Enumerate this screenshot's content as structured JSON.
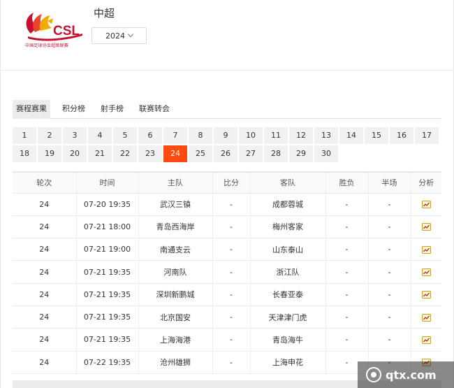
{
  "league": {
    "logo_text": "CSL",
    "logo_caption": "中国足球协会超级联赛",
    "title": "中超",
    "season": "2024"
  },
  "tabs": [
    {
      "label": "赛程赛果",
      "active": true
    },
    {
      "label": "积分榜",
      "active": false
    },
    {
      "label": "射手榜",
      "active": false
    },
    {
      "label": "联赛转会",
      "active": false
    }
  ],
  "rounds": {
    "row1": [
      "1",
      "2",
      "3",
      "4",
      "5",
      "6",
      "7",
      "8",
      "9",
      "10",
      "11",
      "12",
      "13",
      "14",
      "15",
      "16",
      "17"
    ],
    "row2": [
      "18",
      "19",
      "20",
      "21",
      "22",
      "23",
      "24",
      "25",
      "26",
      "27",
      "28",
      "29",
      "30"
    ],
    "active": "24"
  },
  "table": {
    "headers": [
      "轮次",
      "时间",
      "主队",
      "比分",
      "客队",
      "胜负",
      "半场",
      "分析"
    ],
    "rows": [
      {
        "round": "24",
        "time": "07-20 19:35",
        "home": "武汉三镇",
        "score": "-",
        "away": "成都蓉城",
        "result": "-",
        "half": "-"
      },
      {
        "round": "24",
        "time": "07-21 18:00",
        "home": "青岛西海岸",
        "score": "-",
        "away": "梅州客家",
        "result": "-",
        "half": "-"
      },
      {
        "round": "24",
        "time": "07-21 19:00",
        "home": "南通支云",
        "score": "-",
        "away": "山东泰山",
        "result": "-",
        "half": "-"
      },
      {
        "round": "24",
        "time": "07-21 19:35",
        "home": "河南队",
        "score": "-",
        "away": "浙江队",
        "result": "-",
        "half": "-"
      },
      {
        "round": "24",
        "time": "07-21 19:35",
        "home": "深圳新鹏城",
        "score": "-",
        "away": "长春亚泰",
        "result": "-",
        "half": "-"
      },
      {
        "round": "24",
        "time": "07-21 19:35",
        "home": "北京国安",
        "score": "-",
        "away": "天津津门虎",
        "result": "-",
        "half": "-"
      },
      {
        "round": "24",
        "time": "07-21 19:35",
        "home": "上海海港",
        "score": "-",
        "away": "青岛海牛",
        "result": "-",
        "half": "-"
      },
      {
        "round": "24",
        "time": "07-22 19:35",
        "home": "沧州雄狮",
        "score": "-",
        "away": "上海申花",
        "result": "-",
        "half": "-"
      }
    ]
  },
  "watermark": "qtx.com",
  "colors": {
    "accent": "#ff4b12",
    "score": "#e03a1e",
    "logo_red": "#c8102e",
    "logo_gold": "#f2a900"
  }
}
